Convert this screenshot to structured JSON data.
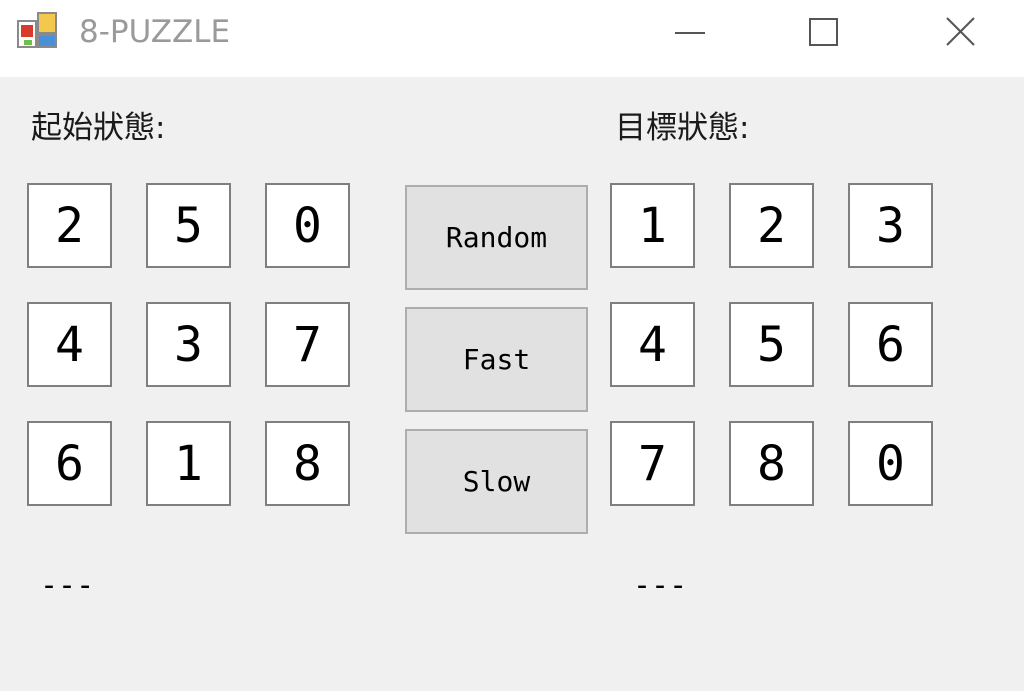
{
  "window": {
    "title": "8-PUZZLE",
    "icon": "window-app-icon",
    "controls": [
      "minimize-icon",
      "maximize-icon",
      "close-icon"
    ]
  },
  "start": {
    "label": "起始狀態:",
    "tiles": [
      "2",
      "5",
      "0",
      "4",
      "3",
      "7",
      "6",
      "1",
      "8"
    ],
    "status": "---"
  },
  "goal": {
    "label": "目標狀態:",
    "tiles": [
      "1",
      "2",
      "3",
      "4",
      "5",
      "6",
      "7",
      "8",
      "0"
    ],
    "status": "---"
  },
  "buttons": {
    "random": "Random",
    "fast": "Fast",
    "slow": "Slow"
  },
  "colors": {
    "background": "#f0f0f0",
    "titlebar": "#ffffff",
    "tile_border": "#7f7f7f",
    "button_face": "#e1e1e1"
  }
}
